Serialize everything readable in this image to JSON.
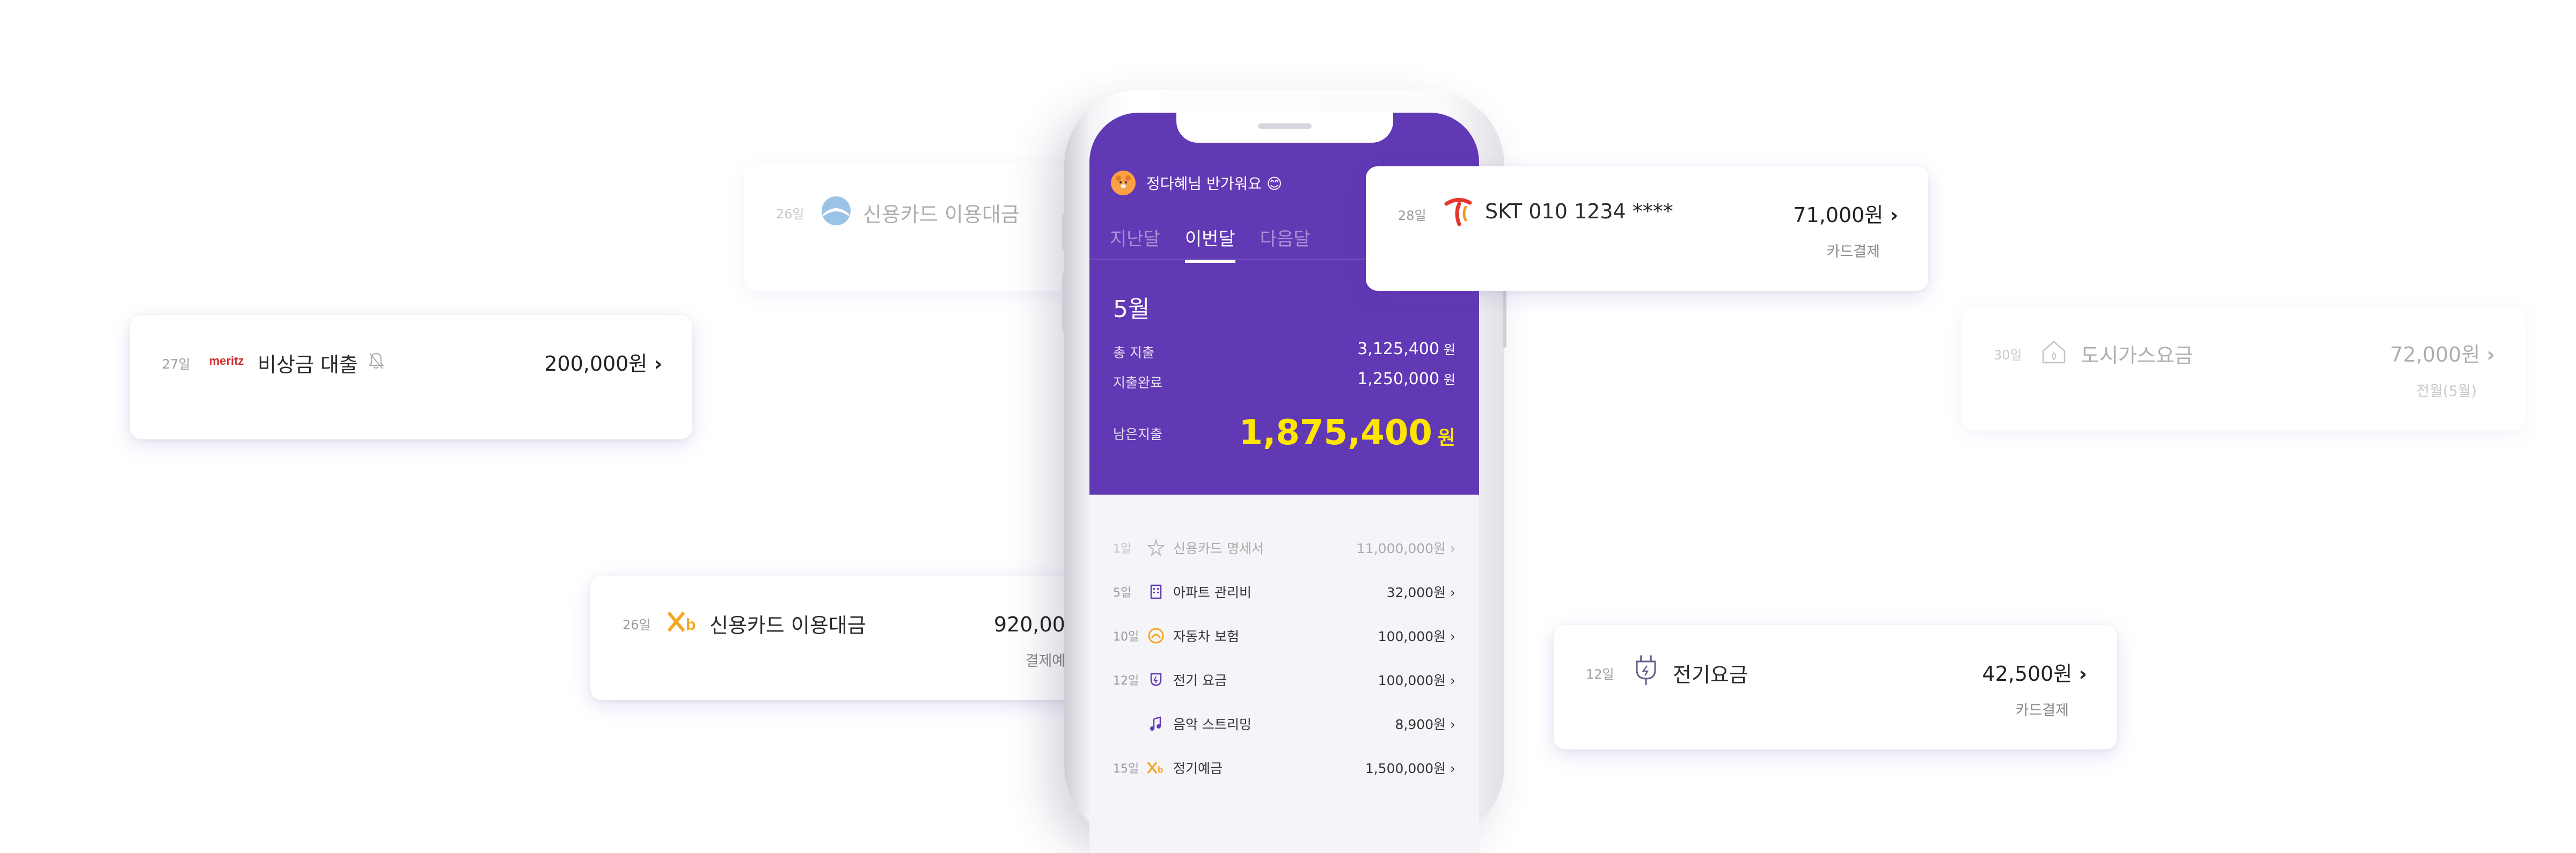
{
  "phone": {
    "greeting": "정다혜님 반가워요 😊",
    "tabs": [
      "지난달",
      "이번달",
      "다음달"
    ],
    "month": "5월",
    "total_label": "총 지출",
    "total_value": "3,125,400",
    "paid_label": "지출완료",
    "paid_value": "1,250,000",
    "remain_label": "남은지출",
    "remain_value": "1,875,400",
    "won": "원",
    "list": [
      {
        "day": "1일",
        "title": "신용카드 명세서",
        "amount": "11,000,000원 ›",
        "icon": "shinhan-icon"
      },
      {
        "day": "5일",
        "title": "아파트 관리비",
        "amount": "32,000원 ›",
        "icon": "building-icon"
      },
      {
        "day": "10일",
        "title": "자동차 보험",
        "amount": "100,000원 ›",
        "icon": "insurance-icon"
      },
      {
        "day": "12일",
        "title": "전기 요금",
        "amount": "100,000원 ›",
        "icon": "plug-icon"
      },
      {
        "day": "",
        "title": "음악 스트리밍",
        "amount": "8,900원 ›",
        "icon": "music-icon"
      },
      {
        "day": "15일",
        "title": "정기예금",
        "amount": "1,500,000원 ›",
        "icon": "kb-icon"
      }
    ]
  },
  "cards": {
    "meritz": {
      "day": "27일",
      "name": "비상금 대출",
      "amount": "200,000원",
      "logo_text": "meritz"
    },
    "kb": {
      "day": "26일",
      "name": "신용카드 이용대금",
      "amount": "920,000원",
      "sub": "결제예정"
    },
    "shinhan": {
      "day": "26일",
      "name": "신용카드 이용대금"
    },
    "skt": {
      "day": "28일",
      "name": "SKT 010 1234 ****",
      "amount": "71,000원",
      "sub": "카드결제"
    },
    "gas": {
      "day": "30일",
      "name": "도시가스요금",
      "amount": "72,000원",
      "sub": "전월(5월)"
    },
    "elec": {
      "day": "12일",
      "name": "전기요금",
      "amount": "42,500원",
      "sub": "카드결제"
    }
  },
  "colors": {
    "brand_purple": "#6139b4",
    "remain_yellow": "#ffe600"
  }
}
